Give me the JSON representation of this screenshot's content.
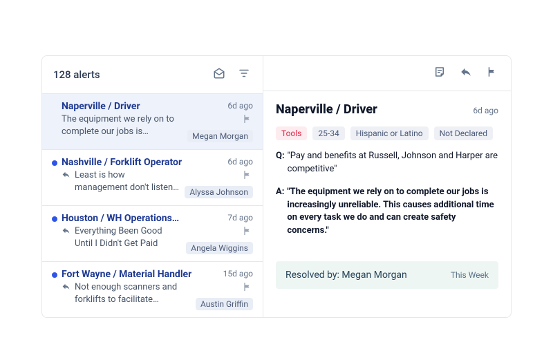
{
  "header": {
    "alerts_count_text": "128 alerts"
  },
  "alerts": [
    {
      "title": "Naperville / Driver",
      "time": "6d ago",
      "unread": false,
      "replied": false,
      "preview": "The equipment we rely on to complete our jobs is increasingly…",
      "assignee": "Megan Morgan",
      "selected": true
    },
    {
      "title": "Nashville / Forklift Operator",
      "time": "6d ago",
      "unread": true,
      "replied": true,
      "preview": "Least is how management don't listen when we are trying to tell…",
      "assignee": "Alyssa Johnson",
      "selected": false
    },
    {
      "title": "Houston / WH Operations…",
      "time": "7d ago",
      "unread": true,
      "replied": true,
      "preview": "Everything Been Good Until I Didn't Get Paid",
      "assignee": "Angela Wiggins",
      "selected": false
    },
    {
      "title": "Fort Wayne / Material Handler",
      "time": "15d ago",
      "unread": true,
      "replied": true,
      "preview": "Not enough scanners and forklifts to facilitate everyone that needs one",
      "assignee": "Austin Griffin",
      "selected": false
    }
  ],
  "detail": {
    "title": "Naperville / Driver",
    "time": "6d ago",
    "tags": [
      {
        "label": "Tools",
        "color": "red"
      },
      {
        "label": "25-34",
        "color": "default"
      },
      {
        "label": "Hispanic or Latino",
        "color": "default"
      },
      {
        "label": "Not Declared",
        "color": "default"
      }
    ],
    "question_label": "Q:",
    "question_text": "\"Pay and benefits at Russell, Johnson and Harper are competitive\"",
    "answer_label": "A:",
    "answer_text": "\"The equipment we rely on to complete our jobs is increasingly unreliable. This causes additional time on every task we do and can create safety concerns.\"",
    "resolved_label": "Resolved by: Megan Morgan",
    "resolved_when": "This Week"
  }
}
